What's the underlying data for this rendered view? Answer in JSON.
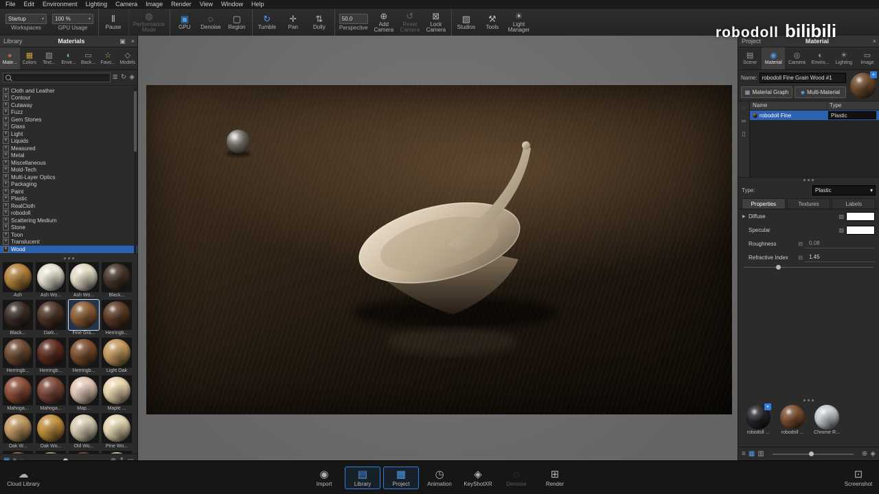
{
  "watermark": {
    "part1": "robodoll",
    "part2": "bilibili"
  },
  "icons": {
    "close": "×",
    "caret": "▾",
    "expander": "+",
    "plus_badge": "+",
    "undock": "▣",
    "expand_arrow": "▶",
    "texture_map": "▨",
    "map_small": "⊟"
  },
  "menu": {
    "items": [
      {
        "label": "File"
      },
      {
        "label": "Edit"
      },
      {
        "label": "Environment"
      },
      {
        "label": "Lighting"
      },
      {
        "label": "Camera"
      },
      {
        "label": "Image"
      },
      {
        "label": "Render"
      },
      {
        "label": "View"
      },
      {
        "label": "Window"
      },
      {
        "label": "Help"
      }
    ]
  },
  "toolbar": {
    "workspace": {
      "value": "Startup",
      "label": "Workspaces"
    },
    "gpu_usage": {
      "value": "100 %",
      "label": "GPU Usage"
    },
    "perspective": {
      "value": "50.0",
      "label": "Perspective"
    },
    "buttons1": [
      {
        "icon": "pause-icon",
        "glyph": "Ⅱ",
        "label": "Pause",
        "sep_before": true
      },
      {
        "icon": "performance-mode-icon",
        "glyph": "◍",
        "label": "Performance\nMode",
        "dim": true,
        "sep_before": true
      },
      {
        "icon": "gpu-icon",
        "glyph": "▣",
        "label": "GPU",
        "active": true,
        "sep_before": true
      },
      {
        "icon": "denoise-icon",
        "glyph": "◌",
        "label": "Denoise"
      },
      {
        "icon": "region-icon",
        "glyph": "▢",
        "label": "Region"
      },
      {
        "icon": "tumble-icon",
        "glyph": "↻",
        "label": "Tumble",
        "active": true,
        "sep_before": true
      },
      {
        "icon": "pan-icon",
        "glyph": "✛",
        "label": "Pan"
      },
      {
        "icon": "dolly-icon",
        "glyph": "⇅",
        "label": "Dolly"
      }
    ],
    "buttons2": [
      {
        "icon": "add-camera-icon",
        "glyph": "⊕",
        "label": "Add\nCamera"
      },
      {
        "icon": "reset-camera-icon",
        "glyph": "↺",
        "label": "Reset\nCamera",
        "dim": true
      },
      {
        "icon": "lock-camera-icon",
        "glyph": "⊠",
        "label": "Lock\nCamera"
      },
      {
        "icon": "studios-icon",
        "glyph": "▧",
        "label": "Studios",
        "sep_before": true
      },
      {
        "icon": "tools-icon",
        "glyph": "⚒",
        "label": "Tools"
      },
      {
        "icon": "light-manager-icon",
        "glyph": "☀",
        "label": "Light\nManager"
      }
    ]
  },
  "library": {
    "window_label": "Library",
    "title": "Materials",
    "tabs": [
      {
        "icon": "materials-tab-icon",
        "glyph": "●",
        "label": "Mate...",
        "active": true,
        "glyph_color": "#b8604a"
      },
      {
        "icon": "colors-tab-icon",
        "glyph": "▦",
        "label": "Colors",
        "glyph_color": "#c8a23a"
      },
      {
        "icon": "textures-tab-icon",
        "glyph": "▨",
        "label": "Text..."
      },
      {
        "icon": "environments-tab-icon",
        "glyph": "◐",
        "label": "Envir...",
        "glyph_color": "#6ab0d8"
      },
      {
        "icon": "backplates-tab-icon",
        "glyph": "▭",
        "label": "Back..."
      },
      {
        "icon": "favorites-tab-icon",
        "glyph": "☆",
        "label": "Favo...",
        "glyph_color": "#c8b44a"
      },
      {
        "icon": "models-tab-icon",
        "glyph": "◇",
        "label": "Models"
      }
    ],
    "search_icons": [
      {
        "icon": "filter-icon",
        "glyph": "≣"
      },
      {
        "icon": "refresh-icon",
        "glyph": "↻"
      },
      {
        "icon": "options-icon",
        "glyph": "◈"
      }
    ],
    "tree": [
      {
        "label": "Cloth and Leather"
      },
      {
        "label": "Contour"
      },
      {
        "label": "Cutaway"
      },
      {
        "label": "Fuzz"
      },
      {
        "label": "Gem Stones"
      },
      {
        "label": "Glass"
      },
      {
        "label": "Light"
      },
      {
        "label": "Liquids"
      },
      {
        "label": "Measured"
      },
      {
        "label": "Metal"
      },
      {
        "label": "Miscellaneous"
      },
      {
        "label": "Mold-Tech"
      },
      {
        "label": "Multi-Layer Optics"
      },
      {
        "label": "Packaging"
      },
      {
        "label": "Paint"
      },
      {
        "label": "Plastic"
      },
      {
        "label": "RealCloth"
      },
      {
        "label": "robodoll"
      },
      {
        "label": "Scattering Medium"
      },
      {
        "label": "Stone"
      },
      {
        "label": "Toon"
      },
      {
        "label": "Translucent"
      },
      {
        "label": "Wood",
        "selected": true
      }
    ],
    "materials": [
      {
        "label": "Ash",
        "color": "#b5833c"
      },
      {
        "label": "Ash Wo...",
        "color": "#e7e3d4"
      },
      {
        "label": "Ash Wo...",
        "color": "#e2dbc6"
      },
      {
        "label": "Black...",
        "color": "#46342a"
      },
      {
        "label": "Black...",
        "color": "#3b2d26"
      },
      {
        "label": "Dark...",
        "color": "#4e3426"
      },
      {
        "label": "Fine Gra...",
        "color": "#8a5c36",
        "selected": true
      },
      {
        "label": "Herringb...",
        "color": "#5c3b24"
      },
      {
        "label": "Herringb...",
        "color": "#6e4a33"
      },
      {
        "label": "Herringb...",
        "color": "#5e2d1d"
      },
      {
        "label": "Herringb...",
        "color": "#7c4e2c"
      },
      {
        "label": "Light Oak",
        "color": "#c69a5f"
      },
      {
        "label": "Mahoga...",
        "color": "#8e4e36"
      },
      {
        "label": "Mahoga...",
        "color": "#7c4839"
      },
      {
        "label": "Map...",
        "color": "#e2c8b6"
      },
      {
        "label": "Maple ...",
        "color": "#ead6ae"
      },
      {
        "label": "Oak W...",
        "color": "#c49a63"
      },
      {
        "label": "Oak Wo...",
        "color": "#c3913d"
      },
      {
        "label": "Old Wo...",
        "color": "#d9cdb2"
      },
      {
        "label": "Pine Wo...",
        "color": "#e6d7b2"
      },
      {
        "label": "",
        "color": "#8a6a4a"
      },
      {
        "label": "",
        "color": "#b09a7a"
      },
      {
        "label": "",
        "color": "#6a4a34"
      },
      {
        "label": "",
        "color": "#d8c8a8"
      }
    ],
    "footer_left": [
      {
        "icon": "thumbnail-view-icon",
        "glyph": "▦",
        "active": true
      },
      {
        "icon": "list-view-icon",
        "glyph": "≡"
      },
      {
        "icon": "search-library-icon",
        "glyph": "◌"
      }
    ],
    "footer_right": [
      {
        "icon": "zoom-in-icon",
        "glyph": "⊕"
      },
      {
        "icon": "upload-icon",
        "glyph": "↥"
      },
      {
        "icon": "folder-icon",
        "glyph": "▭"
      }
    ]
  },
  "project": {
    "window_label": "Project",
    "title": "Material",
    "tabs": [
      {
        "icon": "scene-tab-icon",
        "glyph": "▤",
        "label": "Scene"
      },
      {
        "icon": "material-tab-icon",
        "glyph": "◉",
        "label": "Material",
        "active": true
      },
      {
        "icon": "camera-tab-icon",
        "glyph": "◎",
        "label": "Camera"
      },
      {
        "icon": "environment-tab-icon",
        "glyph": "◐",
        "label": "Enviro..."
      },
      {
        "icon": "lighting-tab-icon",
        "glyph": "☀",
        "label": "Lighting"
      },
      {
        "icon": "image-tab-icon",
        "glyph": "▭",
        "label": "Image"
      }
    ],
    "name_label": "Name:",
    "name_value": "robodoll Fine Grain Wood #1",
    "preview_color": "#6e4a2c",
    "material_graph_label": "Material Graph",
    "multi_material_label": "Multi-Material",
    "rail": [
      {
        "icon": "search-materials-icon",
        "glyph": "◌"
      },
      {
        "icon": "link-material-icon",
        "glyph": "∞"
      },
      {
        "icon": "paste-material-icon",
        "glyph": "▯"
      }
    ],
    "list": {
      "name_col": "Name",
      "type_col": "Type",
      "rows": [
        {
          "name": "robodoll Fine",
          "type": "Plastic",
          "selected": true,
          "color": "#8a5a3a"
        }
      ]
    },
    "type_label": "Type:",
    "type_value": "Plastic",
    "prop_tabs": [
      {
        "label": "Properties",
        "active": true
      },
      {
        "label": "Textures"
      },
      {
        "label": "Labels"
      }
    ],
    "props": {
      "diffuse": {
        "label": "Diffuse",
        "swatch": "#ffffff"
      },
      "specular": {
        "label": "Specular",
        "swatch": "#ffffff"
      },
      "roughness": {
        "label": "Roughness",
        "value": "0.08"
      },
      "refractive_index": {
        "label": "Refractive Index",
        "value": "1.45"
      }
    },
    "thumbnails": [
      {
        "label": "robodoll ...",
        "color": "#26262b",
        "badge": true
      },
      {
        "label": "robodoll ...",
        "color": "#7d4f30"
      },
      {
        "label": "Chrome R...",
        "color": "#c9ced2"
      }
    ],
    "footer_left": [
      {
        "icon": "list-view-icon",
        "glyph": "≡"
      },
      {
        "icon": "thumbnail-view-icon",
        "glyph": "▦",
        "active": true
      },
      {
        "icon": "detail-view-icon",
        "glyph": "▥"
      }
    ],
    "footer_right": [
      {
        "icon": "zoom-in-icon",
        "glyph": "⊕"
      },
      {
        "icon": "options-icon",
        "glyph": "◈"
      }
    ]
  },
  "ribbon": {
    "cloud": {
      "icon": "cloud-library-icon",
      "glyph": "☁",
      "label": "Cloud Library"
    },
    "items": [
      {
        "icon": "import-icon",
        "glyph": "◉",
        "label": "Import"
      },
      {
        "icon": "library-icon",
        "glyph": "▤",
        "label": "Library",
        "active": true
      },
      {
        "icon": "project-icon",
        "glyph": "▦",
        "label": "Project",
        "active": true
      },
      {
        "icon": "animation-icon",
        "glyph": "◷",
        "label": "Animation"
      },
      {
        "icon": "keyshotxr-icon",
        "glyph": "◈",
        "label": "KeyShotXR"
      },
      {
        "icon": "denoise-icon",
        "glyph": "◌",
        "label": "Denoise",
        "dim": true
      },
      {
        "icon": "render-icon",
        "glyph": "⊞",
        "label": "Render"
      }
    ],
    "screenshot": {
      "icon": "screenshot-icon",
      "glyph": "⊡",
      "label": "Screenshot"
    }
  }
}
